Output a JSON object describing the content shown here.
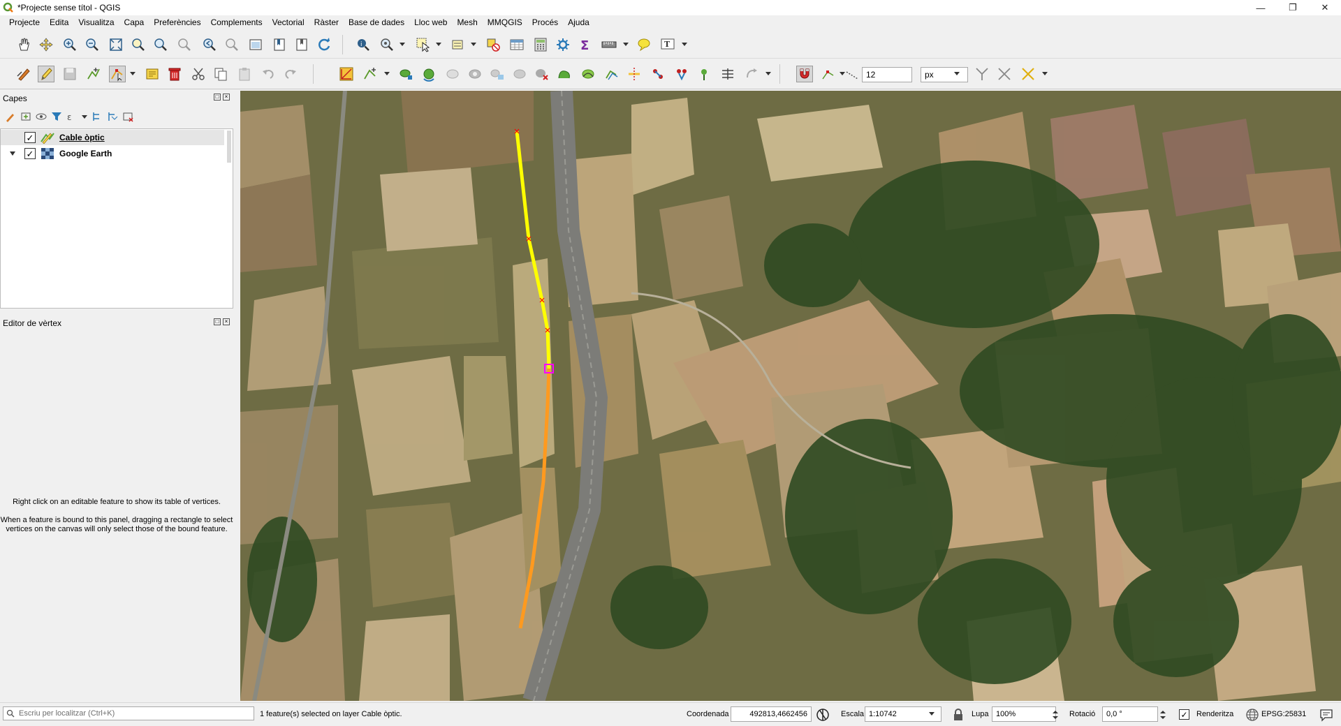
{
  "window": {
    "title": "*Projecte sense títol - QGIS",
    "controls": [
      "minimize",
      "restore",
      "close"
    ]
  },
  "menu": [
    "Projecte",
    "Edita",
    "Visualitza",
    "Capa",
    "Preferències",
    "Complements",
    "Vectorial",
    "Ràster",
    "Base de dades",
    "Lloc web",
    "Mesh",
    "MMQGIS",
    "Procés",
    "Ajuda"
  ],
  "snapping": {
    "tolerance": "12",
    "units": "px"
  },
  "layers_panel": {
    "title": "Capes",
    "layers": [
      {
        "name": "Cable òptic",
        "checked": true,
        "type": "line",
        "editing": true,
        "selected": true
      },
      {
        "name": "Google Earth",
        "checked": true,
        "type": "raster",
        "expandable": true
      }
    ]
  },
  "vertex_panel": {
    "title": "Editor de vèrtex",
    "help1": "Right click on an editable feature to show its table of vertices.",
    "help2a": "When a feature is bound to this panel, dragging a rectangle to select",
    "help2b": "vertices on the canvas will only select those of the bound feature."
  },
  "status": {
    "locator_placeholder": "Escriu per localitzar (Ctrl+K)",
    "message": "1 feature(s) selected on layer Cable òptic.",
    "coord_label": "Coordenada",
    "coord_value": "492813,4662456",
    "scale_label": "Escala",
    "scale_value": "1:10742",
    "magnifier_label": "Lupa",
    "magnifier_value": "100%",
    "rotation_label": "Rotació",
    "rotation_value": "0,0 °",
    "render_label": "Renderitza",
    "crs": "EPSG:25831"
  },
  "colors": {
    "selected_line": "#ffff00",
    "line": "#ff9a1f",
    "vertex": "#ff0000",
    "active_vertex": "#ff00ff"
  }
}
